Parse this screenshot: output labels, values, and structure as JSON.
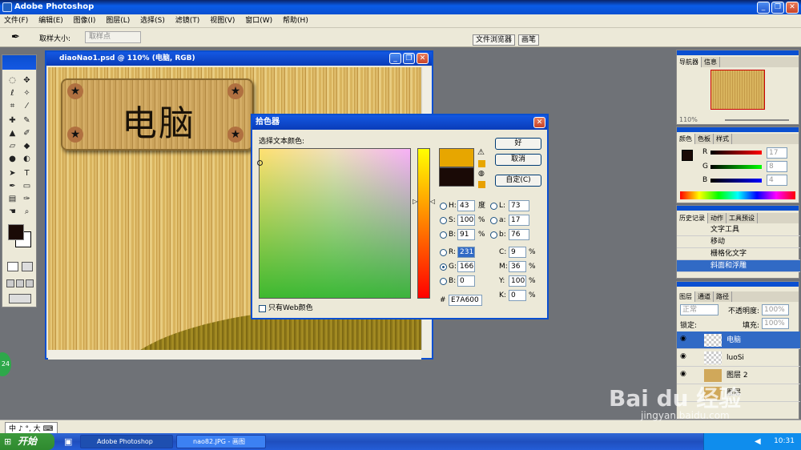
{
  "app": {
    "title": "Adobe Photoshop"
  },
  "menu": [
    "文件(F)",
    "编辑(E)",
    "图像(I)",
    "图层(L)",
    "选择(S)",
    "滤镜(T)",
    "视图(V)",
    "窗口(W)",
    "帮助(H)"
  ],
  "options": {
    "sample_size_label": "取样大小:",
    "sample_value": "取样点",
    "tabs": [
      "文件浏览器",
      "画笔"
    ]
  },
  "document": {
    "title": "diaoNao1.psd @ 110% (电脑, RGB)",
    "sign_text": "电脑",
    "screw": "★"
  },
  "picker": {
    "title": "拾色器",
    "prompt": "选择文本颜色:",
    "ok": "好",
    "cancel": "取消",
    "custom": "自定(C)",
    "web_only": "只有Web颜色",
    "fields": {
      "H": {
        "label": "H:",
        "value": "43",
        "unit": "度"
      },
      "S": {
        "label": "S:",
        "value": "100",
        "unit": "%"
      },
      "B": {
        "label": "B:",
        "value": "91",
        "unit": "%"
      },
      "R": {
        "label": "R:",
        "value": "231"
      },
      "G": {
        "label": "G:",
        "value": "166"
      },
      "Bb": {
        "label": "B:",
        "value": "0"
      },
      "L": {
        "label": "L:",
        "value": "73"
      },
      "a": {
        "label": "a:",
        "value": "17"
      },
      "b": {
        "label": "b:",
        "value": "76"
      },
      "C": {
        "label": "C:",
        "value": "9",
        "unit": "%"
      },
      "M": {
        "label": "M:",
        "value": "36",
        "unit": "%"
      },
      "Y": {
        "label": "Y:",
        "value": "100",
        "unit": "%"
      },
      "K": {
        "label": "K:",
        "value": "0",
        "unit": "%"
      }
    },
    "hex_label": "#",
    "hex": "E7A600",
    "new_color": "#e7a600",
    "old_color": "#1a0a06"
  },
  "navigator": {
    "tabs": [
      "导航器",
      "信息"
    ],
    "zoom": "110%"
  },
  "color_panel": {
    "tabs": [
      "颜色",
      "色板",
      "样式"
    ],
    "R": {
      "label": "R",
      "value": "17"
    },
    "G": {
      "label": "G",
      "value": "8"
    },
    "B": {
      "label": "B",
      "value": "4"
    }
  },
  "history": {
    "tabs": [
      "历史记录",
      "动作",
      "工具预设"
    ],
    "items": [
      "文字工具",
      "移动",
      "栅格化文字",
      "斜面和浮雕"
    ]
  },
  "layers": {
    "tabs": [
      "图层",
      "通道",
      "路径"
    ],
    "mode": "正常",
    "opacity_label": "不透明度:",
    "opacity": "100%",
    "lock_label": "锁定:",
    "fill_label": "填充:",
    "fill": "100%",
    "items": [
      "电脑",
      "luoSi",
      "图层 2",
      "图层"
    ]
  },
  "taskbar": {
    "start": "开始",
    "tasks": [
      "Adobe Photoshop",
      "nao82.JPG - 画图"
    ],
    "time": "10:31"
  },
  "status": {
    "ime": "中 ♪ °, 大 ⌨"
  },
  "watermark": {
    "brand": "Bai du 经验",
    "url": "jingyan.baidu.com"
  },
  "badge": "24"
}
